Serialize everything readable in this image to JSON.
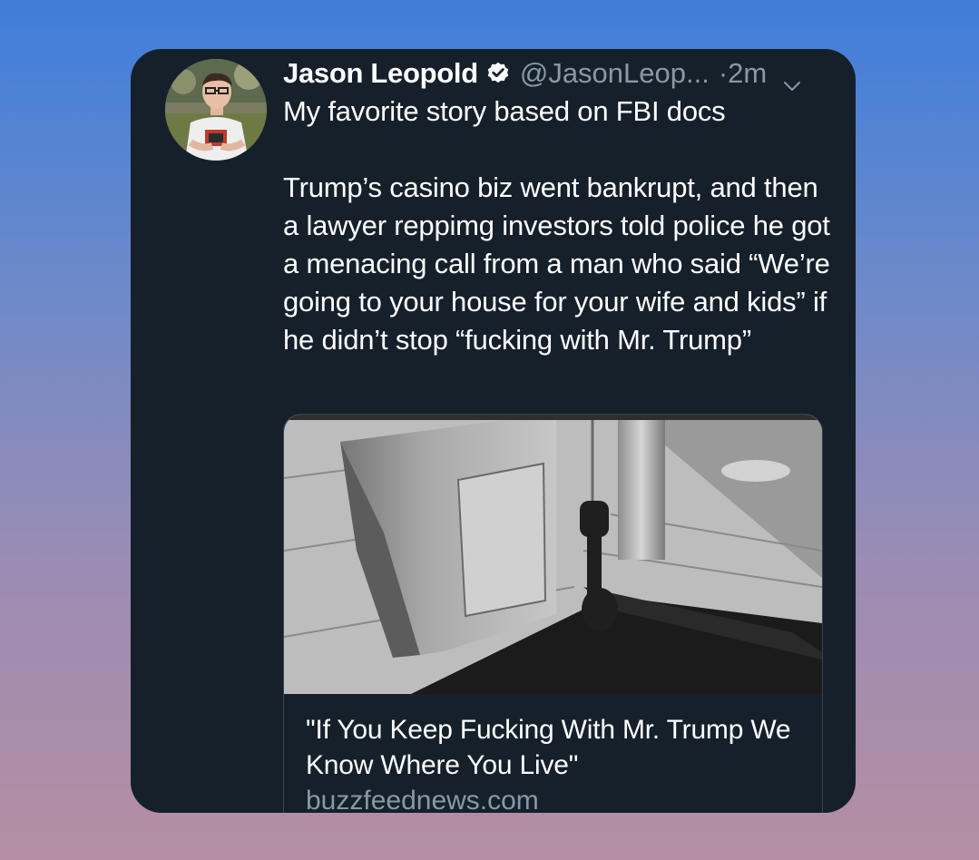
{
  "tweet": {
    "author_name": "Jason Leopold",
    "handle": "@JasonLeop...",
    "separator": "·",
    "time": "2m",
    "text": "My favorite story based on FBI docs\n\nTrump’s casino biz went bankrupt, and then a lawyer reppimg investors told police he got a menacing call from a man who said “We’re going to your house for your wife and kids” if he didn’t stop “fucking with Mr. Trump”",
    "verified_icon": "verified-badge-icon",
    "menu_icon": "chevron-down-icon"
  },
  "link_card": {
    "title": "\"If You Keep Fucking With Mr. Trump We Know Where You Live\"",
    "domain": "buzzfeednews.com"
  },
  "colors": {
    "card_background": "#15202b",
    "text_primary": "#ffffff",
    "text_secondary": "#8899a6",
    "verified_badge": "#ffffff",
    "page_gradient_top": "#3f7edb",
    "page_gradient_bottom": "#b58ea3"
  }
}
